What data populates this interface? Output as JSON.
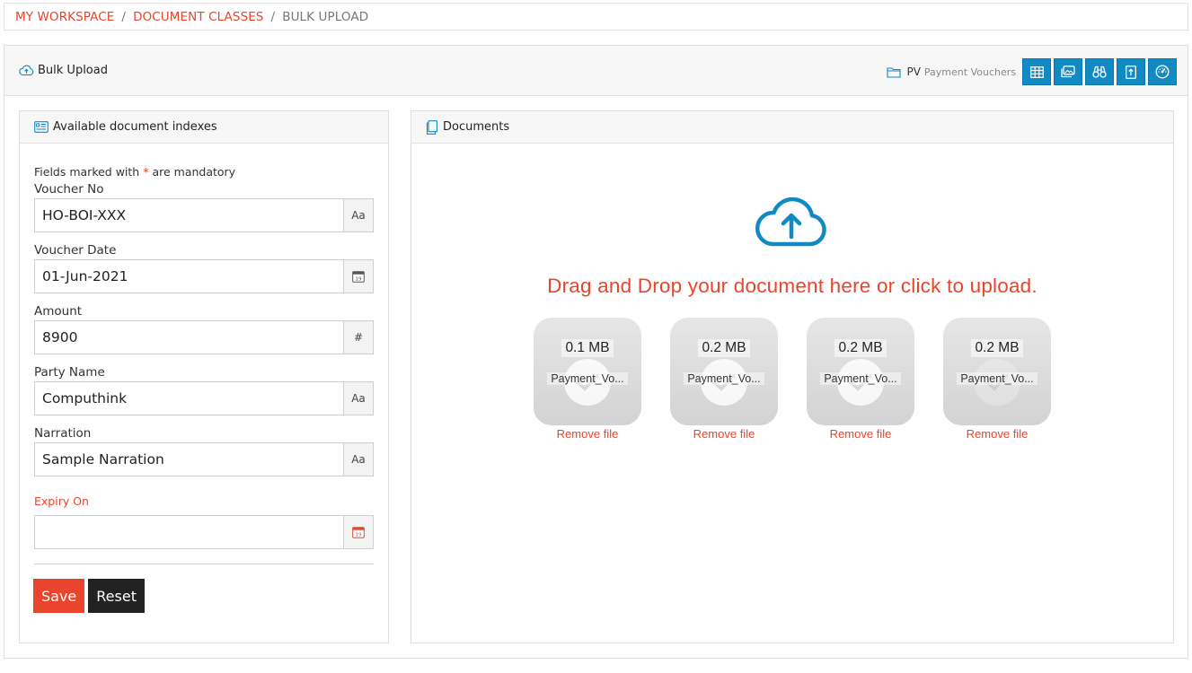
{
  "breadcrumb": {
    "items": [
      "MY WORKSPACE",
      "DOCUMENT CLASSES"
    ],
    "separator": "/",
    "current": "BULK UPLOAD"
  },
  "header": {
    "title": "Bulk Upload",
    "class_code": "PV",
    "class_name": "Payment Vouchers",
    "tools": [
      "table-icon",
      "gallery-icon",
      "binoculars-icon",
      "upload-file-icon",
      "dashboard-icon"
    ]
  },
  "indexes": {
    "title": "Available document indexes",
    "mandatory_prefix": "Fields marked with",
    "mandatory_star": "*",
    "mandatory_suffix": "are mandatory",
    "fields": [
      {
        "label": "Voucher No",
        "value": "HO-BOI-XXX",
        "addon": "Aa"
      },
      {
        "label": "Voucher Date",
        "value": "01-Jun-2021",
        "addon": "calendar-icon"
      },
      {
        "label": "Amount",
        "value": "8900",
        "addon": "#"
      },
      {
        "label": "Party Name",
        "value": "Computhink",
        "addon": "Aa"
      },
      {
        "label": "Narration",
        "value": "Sample Narration",
        "addon": "Aa"
      },
      {
        "label": "Expiry On",
        "value": "",
        "addon": "calendar-icon"
      }
    ],
    "save_label": "Save",
    "reset_label": "Reset"
  },
  "documents": {
    "title": "Documents",
    "dropzone_message": "Drag and Drop your document here or click to upload.",
    "files": [
      {
        "size": "0.1 MB",
        "name": "Payment_Vo..."
      },
      {
        "size": "0.2 MB",
        "name": "Payment_Vo..."
      },
      {
        "size": "0.2 MB",
        "name": "Payment_Vo..."
      },
      {
        "size": "0.2 MB",
        "name": "Payment_Vo..."
      }
    ],
    "remove_label": "Remove file"
  },
  "colors": {
    "accent": "#e8452c",
    "primary": "#1189c2",
    "dark_button": "#222222"
  }
}
